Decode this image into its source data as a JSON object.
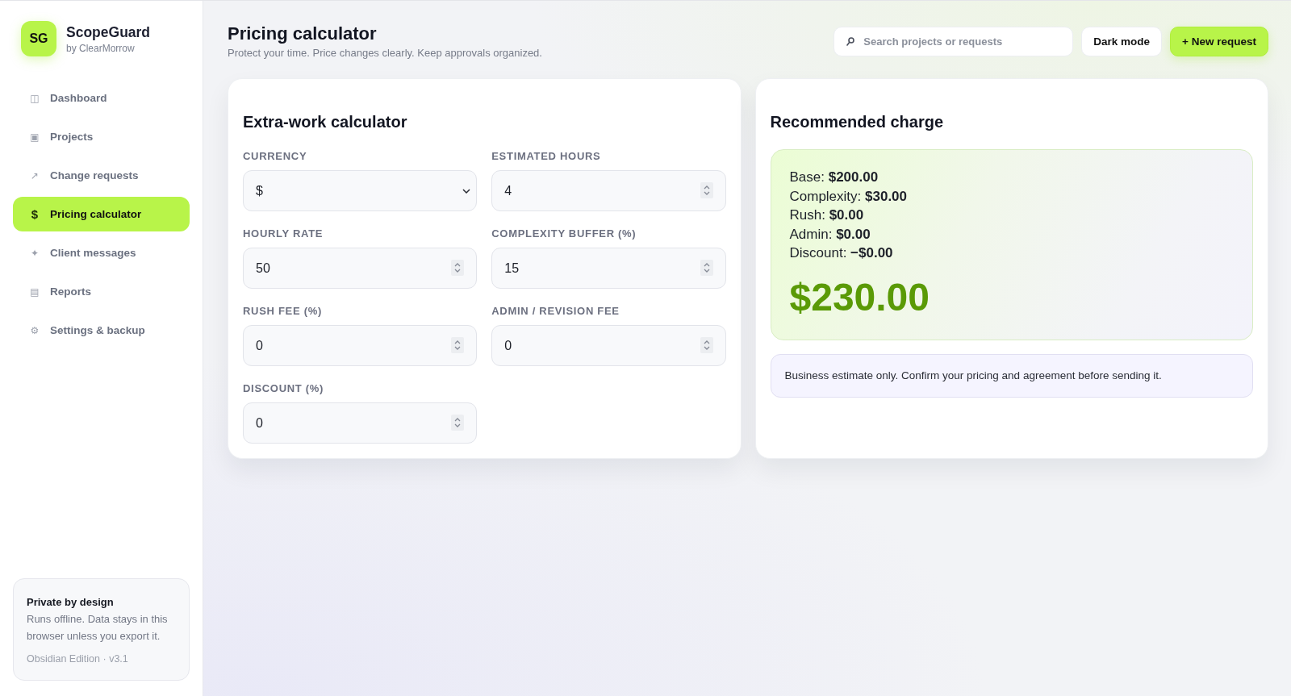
{
  "sidebar": {
    "logo": "SG",
    "brand": "ScopeGuard",
    "byline": "by ClearMorrow",
    "nav": [
      {
        "icon": "◫",
        "label": "Dashboard",
        "selected": false
      },
      {
        "icon": "▣",
        "label": "Projects",
        "selected": false
      },
      {
        "icon": "↗",
        "label": "Change requests",
        "selected": false
      },
      {
        "icon": "$",
        "label": "Pricing calculator",
        "selected": true
      },
      {
        "icon": "✦",
        "label": "Client messages",
        "selected": false
      },
      {
        "icon": "▤",
        "label": "Reports",
        "selected": false
      },
      {
        "icon": "⚙",
        "label": "Settings & backup",
        "selected": false
      }
    ],
    "footer": {
      "title": "Private by design",
      "text": "Runs offline. Data stays in this browser unless you export it.",
      "version": "Obsidian Edition · v3.1"
    }
  },
  "header": {
    "title": "Pricing calculator",
    "subtitle": "Protect your time. Price changes clearly. Keep approvals organized.",
    "search": {
      "placeholder": "Search projects or requests"
    },
    "buttons": [
      {
        "label": "Dark mode",
        "kind": "secondary"
      },
      {
        "label": "+ New request",
        "kind": "primary"
      }
    ]
  },
  "calculator": {
    "title": "Extra-work calculator",
    "fields": [
      {
        "label": "CURRENCY",
        "kind": "select",
        "value": "$"
      },
      {
        "label": "ESTIMATED HOURS",
        "kind": "number",
        "value": "4"
      },
      {
        "label": "HOURLY RATE",
        "kind": "number",
        "value": "50"
      },
      {
        "label": "COMPLEXITY BUFFER (%)",
        "kind": "number",
        "value": "15"
      },
      {
        "label": "RUSH FEE (%)",
        "kind": "number",
        "value": "0"
      },
      {
        "label": "ADMIN / REVISION FEE",
        "kind": "number",
        "value": "0"
      },
      {
        "label": "DISCOUNT (%)",
        "kind": "number",
        "value": "0"
      }
    ]
  },
  "result": {
    "title": "Recommended charge",
    "lines": [
      {
        "label": "Base:",
        "value": "$200.00"
      },
      {
        "label": "Complexity:",
        "value": "$30.00"
      },
      {
        "label": "Rush:",
        "value": "$0.00"
      },
      {
        "label": "Admin:",
        "value": "$0.00"
      },
      {
        "label": "Discount:",
        "value": "−$0.00"
      }
    ],
    "total": "$230.00",
    "note": "Business estimate only. Confirm your pricing and agreement before sending it."
  }
}
